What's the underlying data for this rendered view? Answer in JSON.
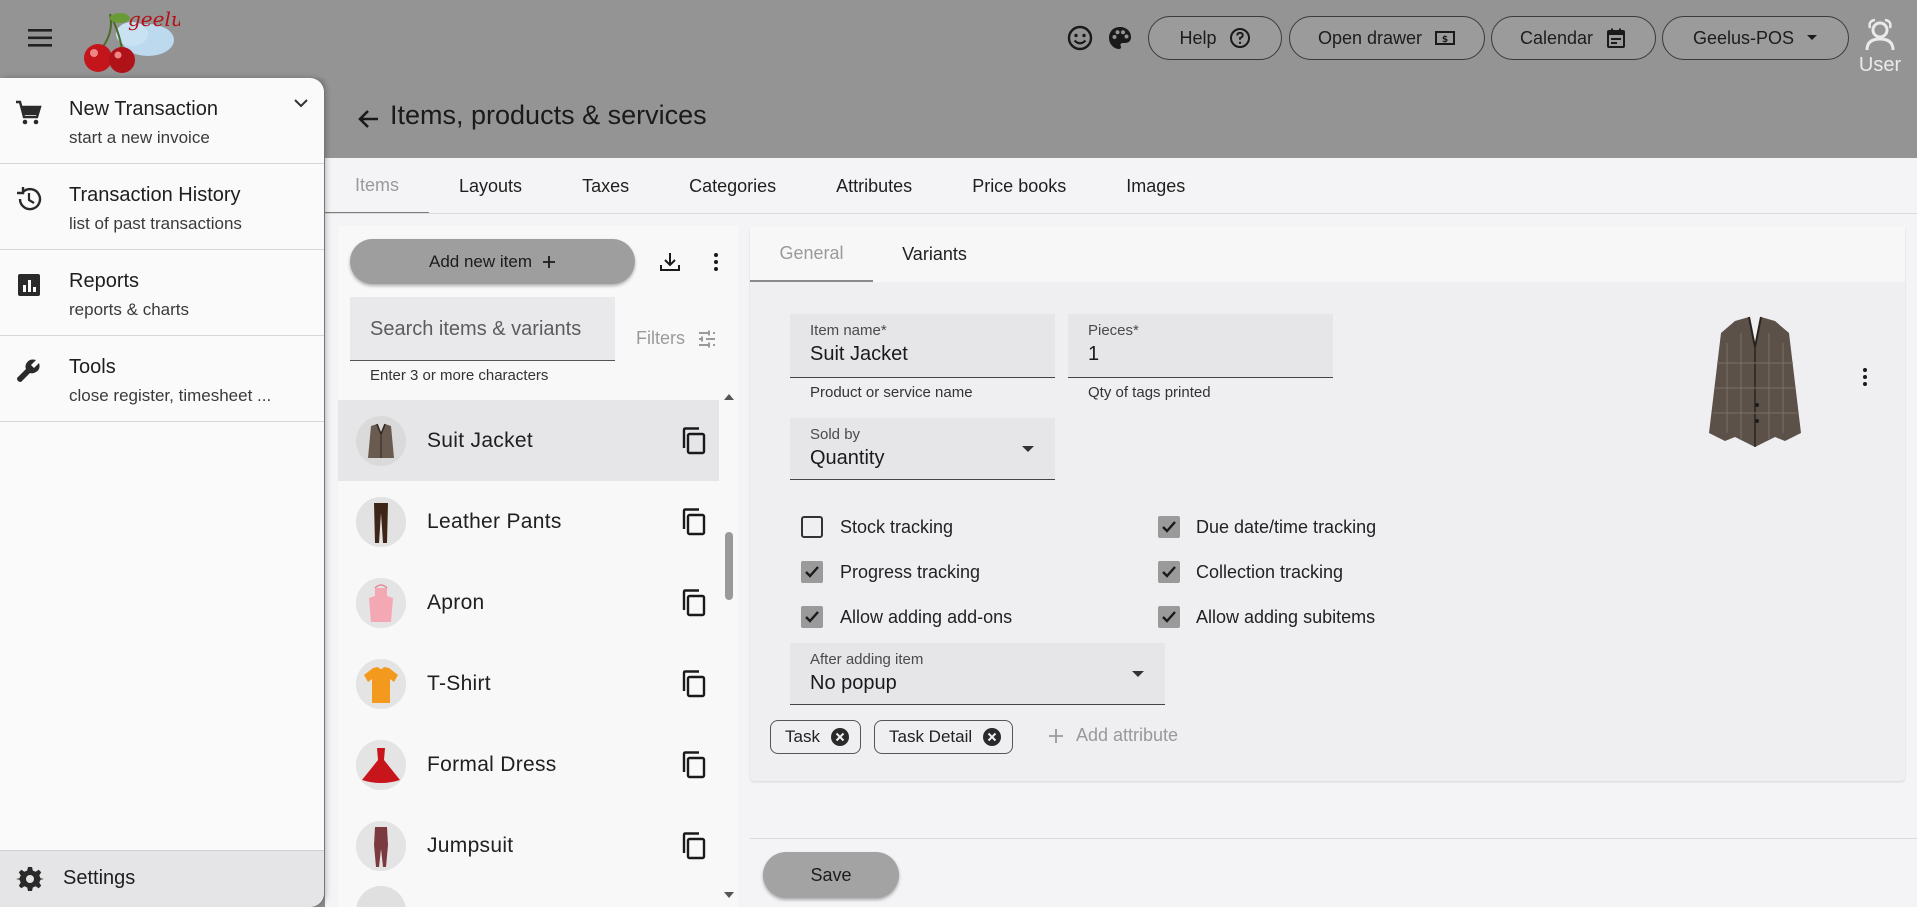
{
  "app": {
    "brand": "geelus",
    "user_label": "User"
  },
  "topbar": {
    "help": "Help",
    "open_drawer": "Open drawer",
    "calendar": "Calendar",
    "register": "Geelus-POS"
  },
  "page": {
    "title": "Items, products & services"
  },
  "tabs": [
    {
      "label": "Items",
      "active": true
    },
    {
      "label": "Layouts"
    },
    {
      "label": "Taxes"
    },
    {
      "label": "Categories"
    },
    {
      "label": "Attributes"
    },
    {
      "label": "Price books"
    },
    {
      "label": "Images"
    }
  ],
  "list": {
    "add_label": "Add new item",
    "search_placeholder": "Search items & variants",
    "search_help": "Enter 3 or more characters",
    "filters_label": "Filters",
    "items": [
      {
        "name": "Suit Jacket",
        "selected": true,
        "icon": "jacket"
      },
      {
        "name": "Leather Pants",
        "icon": "pants"
      },
      {
        "name": "Apron",
        "icon": "apron"
      },
      {
        "name": "T-Shirt",
        "icon": "tshirt"
      },
      {
        "name": "Formal Dress",
        "icon": "dress"
      },
      {
        "name": "Jumpsuit",
        "icon": "jumpsuit"
      }
    ]
  },
  "detail": {
    "tabs": [
      {
        "label": "General",
        "active": true
      },
      {
        "label": "Variants"
      }
    ],
    "item_name": {
      "label": "Item name*",
      "value": "Suit Jacket",
      "helper": "Product or service name"
    },
    "pieces": {
      "label": "Pieces*",
      "value": "1",
      "helper": "Qty of tags printed"
    },
    "sold_by": {
      "label": "Sold by",
      "value": "Quantity"
    },
    "checkboxes": [
      {
        "label": "Stock tracking",
        "checked": false
      },
      {
        "label": "Due date/time tracking",
        "checked": true
      },
      {
        "label": "Progress tracking",
        "checked": true
      },
      {
        "label": "Collection tracking",
        "checked": true
      },
      {
        "label": "Allow adding add-ons",
        "checked": true
      },
      {
        "label": "Allow adding subitems",
        "checked": true
      }
    ],
    "after_adding": {
      "label": "After adding item",
      "value": "No popup"
    },
    "chips": [
      "Task",
      "Task Detail"
    ],
    "add_attribute": "Add attribute",
    "save_label": "Save"
  },
  "drawer": {
    "items": [
      {
        "title": "New Transaction",
        "subtitle": "start a new invoice",
        "icon": "cart-icon"
      },
      {
        "title": "Transaction History",
        "subtitle": "list of past transactions",
        "icon": "history-icon"
      },
      {
        "title": "Reports",
        "subtitle": "reports & charts",
        "icon": "report-icon"
      },
      {
        "title": "Tools",
        "subtitle": "close register, timesheet ...",
        "icon": "wrench-icon"
      }
    ],
    "settings_label": "Settings"
  },
  "colors": {
    "topbar": "#949494",
    "drawer": "#fafafb",
    "accent_gray": "#9e9e9e"
  }
}
